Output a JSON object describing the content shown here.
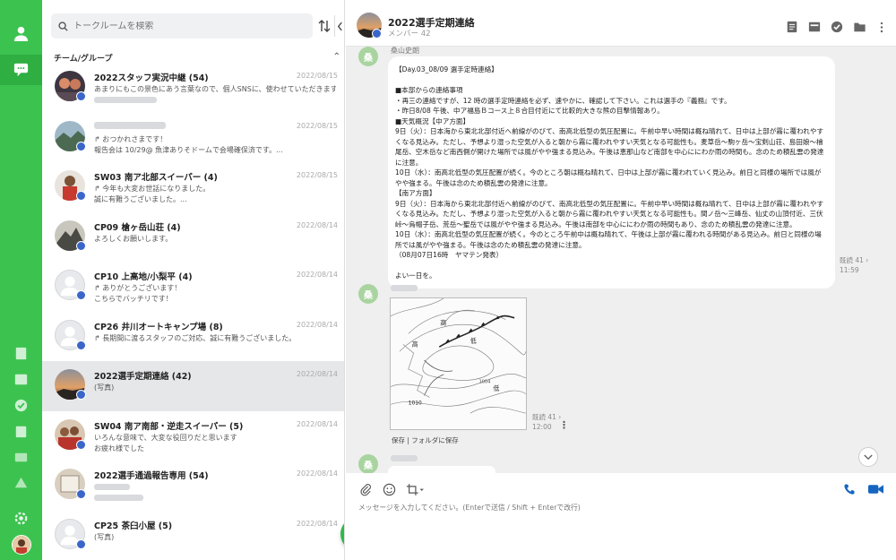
{
  "sidebar": {
    "search": {
      "placeholder": "トークルームを検索"
    },
    "section_label": "チーム/グループ",
    "rooms": [
      {
        "name": "2022スタッフ実況中継 (54)",
        "date": "2022/08/15",
        "line1": "あまりにもこの景色にあう言葉なので、個人SNSに、使わせていただきます",
        "line2": ""
      },
      {
        "name": "",
        "date": "2022/08/15",
        "line1": "↱ おつかれさまです！",
        "line2": "報告会は 10/29@ 魚津ありそドームで会場確保済です。..."
      },
      {
        "name": "SW03 南ア北部スイーパー (4)",
        "date": "2022/08/15",
        "line1": "↱ 今年も大変お世話になりました。",
        "line2": "誠に有難うございました。..."
      },
      {
        "name": "CP09 槍ヶ岳山荘 (4)",
        "date": "2022/08/14",
        "line1": "よろしくお願いします。",
        "line2": ""
      },
      {
        "name": "CP10 上高地/小梨平 (4)",
        "date": "2022/08/14",
        "line1": "↱ ありがとうございます！",
        "line2": "こちらでバッチリです！"
      },
      {
        "name": "CP26 井川オートキャンプ場 (8)",
        "date": "2022/08/14",
        "line1": "↱ 長期間に渡るスタッフのご対応、誠に有難うございました。",
        "line2": ""
      },
      {
        "name": "2022選手定期連絡 (42)",
        "date": "2022/08/14",
        "line1": "(写真)",
        "line2": ""
      },
      {
        "name": "SW04 南ア南部・逆走スイーパー (5)",
        "date": "2022/08/14",
        "line1": "いろんな意味で、大変な役回りだと思います",
        "line2": "お疲れ様でした"
      },
      {
        "name": "2022選手通過報告専用 (54)",
        "date": "2022/08/14",
        "line1": "",
        "line2": ""
      },
      {
        "name": "CP25 茶臼小屋 (5)",
        "date": "2022/08/14",
        "line1": "(写真)",
        "line2": ""
      }
    ]
  },
  "chat": {
    "title": "2022選手定期連絡",
    "members": "メンバー 42",
    "message1": {
      "sender": "桑山史朗",
      "avatar_char": "桑",
      "body": "【Day.03_08/09 選手定時連絡】\n\n■本部からの連絡事項\n・再三の連絡ですが、12 時の選手定時連絡を必ず、速やかに、確認して下さい。これは選手の『義務』です。\n・昨日8/08 午後、中ア福島Ｂコース上８合目付近にて比較的大きな熊の目撃情報あり。\n■天気概況【中ア方面】\n9日（火）：日本海から東北北部付近へ前線がのびて、南高北低型の気圧配置に。午前中早い時間は概ね晴れて、日中は上部が霧に覆われやすくなる見込み。ただし、予想より湿った空気が入ると朝から霧に覆われやすい天気となる可能性も。麦草岳～駒ヶ岳～宝剣山荘、島田娘～檜尾岳、空木岳など南西側が開けた場所では風がやや強まる見込み。午後は恵那山など南部を中心ににわか雨の時間も。念のため積乱雲の発達に注意。\n10日（水）：南高北低型の気圧配置が続く。今のところ朝は概ね晴れて、日中は上部が霧に覆われていく見込み。前日と同様の場所では風がやや強まる。午後は念のため積乱雲の発達に注意。\n【南ア方面】\n9日（火）：日本海から東北北部付近へ前線がのびて、南高北低型の気圧配置に。午前中早い時間は概ね晴れて、日中は上部が霧に覆われやすくなる見込み。ただし、予想より湿った空気が入ると朝から霧に覆われやすい天気となる可能性も。間ノ岳～三峰岳、仙丈の山頂付近、三伏峠～烏帽子岳、荒岳～聖岳では風がやや強まる見込み。午後は南部を中心ににわか雨の時間もあり、念のため積乱雲の発達に注意。\n10日（水）：南高北低型の気圧配置が続く。今のところ午前中は概ね晴れて、午後は上部が霧に覆われる時間がある見込み。前日と同様の場所では風がやや強まる。午後は念のため積乱雲の発達に注意。\n（08月07日16時　ヤマテン発表）\n\nよい一日を。",
      "read": "既読 41 ›",
      "time": "11:59"
    },
    "message2": {
      "avatar_char": "桑",
      "read": "既読 41 ›",
      "time": "12:00",
      "more": "⋮",
      "image_actions": "保存 | フォルダに保存"
    },
    "message3": {
      "avatar_char": "桑"
    },
    "composer": {
      "placeholder": "メッセージを入力してください。(Enterで送信 / Shift + Enterで改行)"
    }
  },
  "colors": {
    "rail": "#3cc34f",
    "accent_blue": "#1565c0",
    "fab": "#2eb94a",
    "badge": "#3b66c9"
  }
}
